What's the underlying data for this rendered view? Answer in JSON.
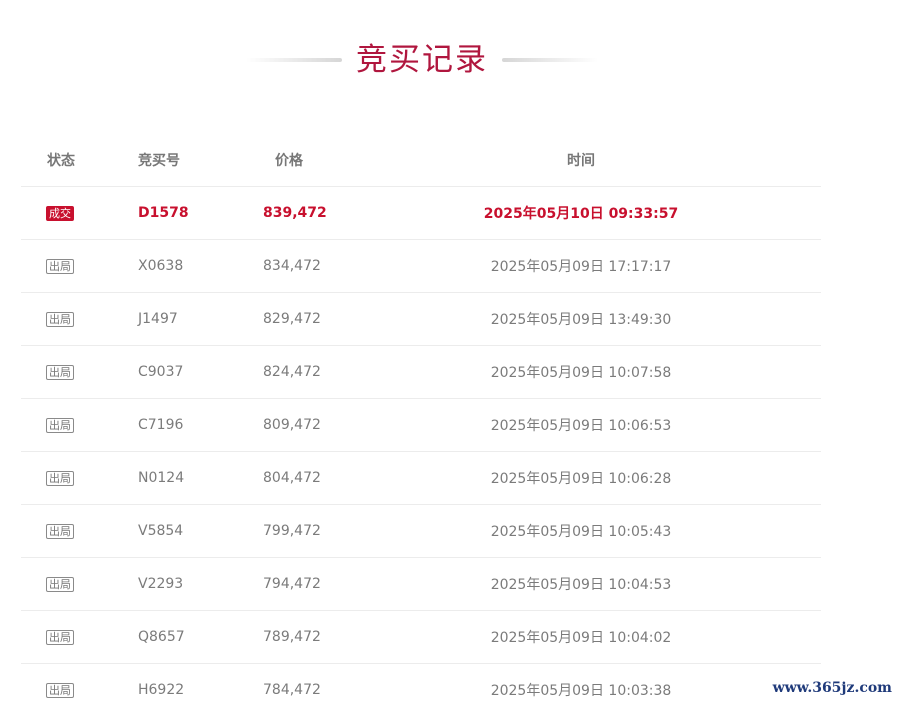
{
  "title": "竞买记录",
  "columns": {
    "status": "状态",
    "bid_no": "竞买号",
    "price": "价格",
    "time": "时间"
  },
  "rows": [
    {
      "status": "成交",
      "bid_no": "D1578",
      "price": "839,472",
      "time": "2025年05月10日 09:33:57"
    },
    {
      "status": "出局",
      "bid_no": "X0638",
      "price": "834,472",
      "time": "2025年05月09日 17:17:17"
    },
    {
      "status": "出局",
      "bid_no": "J1497",
      "price": "829,472",
      "time": "2025年05月09日 13:49:30"
    },
    {
      "status": "出局",
      "bid_no": "C9037",
      "price": "824,472",
      "time": "2025年05月09日 10:07:58"
    },
    {
      "status": "出局",
      "bid_no": "C7196",
      "price": "809,472",
      "time": "2025年05月09日 10:06:53"
    },
    {
      "status": "出局",
      "bid_no": "N0124",
      "price": "804,472",
      "time": "2025年05月09日 10:06:28"
    },
    {
      "status": "出局",
      "bid_no": "V5854",
      "price": "799,472",
      "time": "2025年05月09日 10:05:43"
    },
    {
      "status": "出局",
      "bid_no": "V2293",
      "price": "794,472",
      "time": "2025年05月09日 10:04:53"
    },
    {
      "status": "出局",
      "bid_no": "Q8657",
      "price": "789,472",
      "time": "2025年05月09日 10:04:02"
    },
    {
      "status": "出局",
      "bid_no": "H6922",
      "price": "784,472",
      "time": "2025年05月09日 10:03:38"
    }
  ],
  "watermark": "www.365jz.com",
  "colors": {
    "accent": "#c8102e",
    "title": "#b0163e",
    "muted_text": "#7b7b7b"
  }
}
